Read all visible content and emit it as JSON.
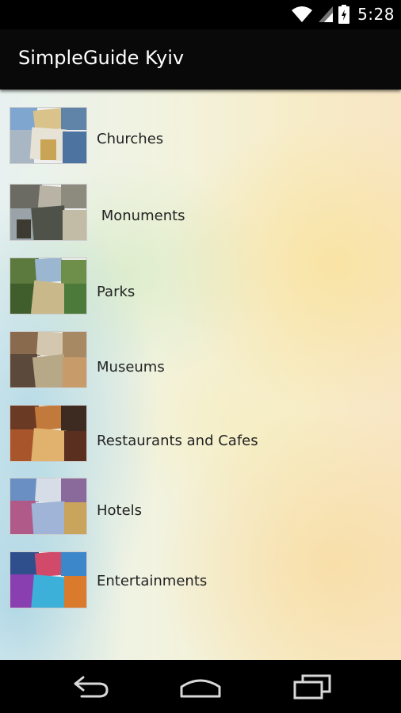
{
  "status_bar": {
    "time": "5:28",
    "icons": [
      "wifi-icon",
      "cell-signal-icon",
      "battery-icon"
    ]
  },
  "app_bar": {
    "title": "SimpleGuide Kyiv"
  },
  "categories": [
    {
      "label": "Churches"
    },
    {
      "label": " Monuments"
    },
    {
      "label": "Parks"
    },
    {
      "label": "Museums"
    },
    {
      "label": "Restaurants and Cafes"
    },
    {
      "label": "Hotels"
    },
    {
      "label": "Entertainments"
    }
  ],
  "nav_bar": {
    "icons": [
      "back-icon",
      "home-icon",
      "recent-apps-icon"
    ]
  }
}
